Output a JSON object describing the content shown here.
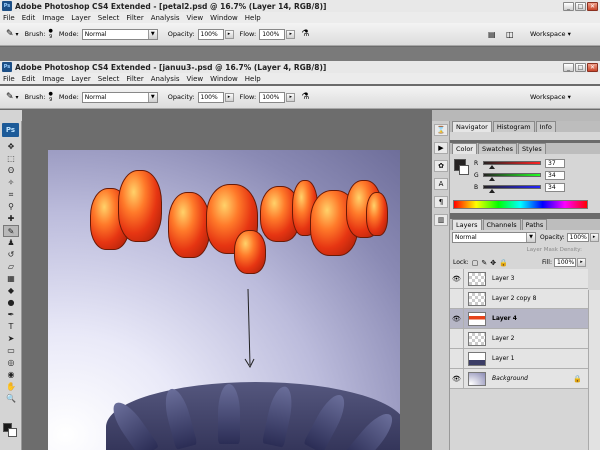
{
  "window_back": {
    "title": "Adobe Photoshop CS4 Extended - [petal2.psd @ 16.7% (Layer 14, RGB/8)]",
    "menu": [
      "File",
      "Edit",
      "Image",
      "Layer",
      "Select",
      "Filter",
      "Analysis",
      "View",
      "Window",
      "Help"
    ],
    "options": {
      "brush_label": "Brush:",
      "brush_size": "9",
      "mode_label": "Mode:",
      "mode_value": "Normal",
      "opacity_label": "Opacity:",
      "opacity_value": "100%",
      "flow_label": "Flow:",
      "flow_value": "100%",
      "workspace": "Workspace"
    }
  },
  "window_front": {
    "title": "Adobe Photoshop CS4 Extended - [januu3-.psd @ 16.7% (Layer 4, RGB/8)]",
    "menu": [
      "File",
      "Edit",
      "Image",
      "Layer",
      "Select",
      "Filter",
      "Analysis",
      "View",
      "Window",
      "Help"
    ],
    "options": {
      "brush_label": "Brush:",
      "brush_size": "9",
      "mode_label": "Mode:",
      "mode_value": "Normal",
      "opacity_label": "Opacity:",
      "opacity_value": "100%",
      "flow_label": "Flow:",
      "flow_value": "100%",
      "workspace": "Workspace"
    }
  },
  "toolbox": {
    "badge": "Ps"
  },
  "navigator_tabs": [
    "Navigator",
    "Histogram",
    "Info"
  ],
  "color_panel": {
    "tabs": [
      "Color",
      "Swatches",
      "Styles"
    ],
    "channels": [
      {
        "label": "R",
        "value": "37",
        "fraction": 0.145
      },
      {
        "label": "G",
        "value": "34",
        "fraction": 0.133
      },
      {
        "label": "B",
        "value": "34",
        "fraction": 0.133
      }
    ],
    "foreground_color": "#252222"
  },
  "layers_panel": {
    "tabs": [
      "Layers",
      "Channels",
      "Paths"
    ],
    "blend_mode": "Normal",
    "opacity_label": "Opacity:",
    "opacity_value": "100%",
    "mask_density_label": "Layer Mask Density:",
    "lock_label": "Lock:",
    "fill_label": "Fill:",
    "fill_value": "100%",
    "layers": [
      {
        "name": "Layer 3",
        "visible": true,
        "active": false
      },
      {
        "name": "Layer 2 copy 8",
        "visible": false,
        "active": false
      },
      {
        "name": "Layer 4",
        "visible": true,
        "active": true
      },
      {
        "name": "Layer 2",
        "visible": false,
        "active": false
      },
      {
        "name": "Layer 1",
        "visible": false,
        "active": false
      },
      {
        "name": "Background",
        "visible": true,
        "active": false,
        "locked": true
      }
    ]
  }
}
